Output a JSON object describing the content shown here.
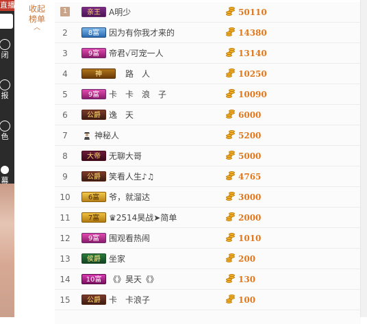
{
  "sidebar": {
    "top_tab": "直播",
    "buttons": [
      {
        "label": "闭",
        "icon": "circle-icon"
      },
      {
        "label": "报",
        "icon": "circle-icon"
      },
      {
        "label": "色",
        "icon": "circle-icon"
      },
      {
        "label": "幕",
        "icon": "toggle-dot-icon"
      }
    ]
  },
  "collapse": {
    "label_line1": "收起",
    "label_line2": "榜单",
    "icon": "chevron-up-icon"
  },
  "ranking": {
    "rows": [
      {
        "rank": "1",
        "badge": "亲王",
        "badge_type": "king",
        "name": "A明少",
        "score": "50110"
      },
      {
        "rank": "2",
        "badge": "8富",
        "badge_type": "w8",
        "name": "因为有你我才来的",
        "score": "14380"
      },
      {
        "rank": "3",
        "badge": "9富",
        "badge_type": "w9",
        "name": "帝君√可宠一人",
        "score": "13140"
      },
      {
        "rank": "4",
        "badge": "神",
        "badge_type": "god",
        "name": "路　人",
        "score": "10250"
      },
      {
        "rank": "5",
        "badge": "9富",
        "badge_type": "w9",
        "name": "卡　卡　浪　子",
        "score": "10090"
      },
      {
        "rank": "6",
        "badge": "公爵",
        "badge_type": "duke",
        "name": "逸　天",
        "score": "6000"
      },
      {
        "rank": "7",
        "badge": "",
        "badge_type": "mystery",
        "name": "神秘人",
        "score": "5200"
      },
      {
        "rank": "8",
        "badge": "大帝",
        "badge_type": "emperor",
        "name": "无聊大哥",
        "score": "5000"
      },
      {
        "rank": "9",
        "badge": "公爵",
        "badge_type": "duke",
        "name": "笑看人生♪♫",
        "score": "4765"
      },
      {
        "rank": "10",
        "badge": "6富",
        "badge_type": "w6",
        "name": "爷，就溜达",
        "score": "3000"
      },
      {
        "rank": "11",
        "badge": "7富",
        "badge_type": "w7",
        "name": "♛2514昊战➤简单",
        "score": "2000"
      },
      {
        "rank": "12",
        "badge": "9富",
        "badge_type": "w9",
        "name": "围观看热闹",
        "score": "1010"
      },
      {
        "rank": "13",
        "badge": "侯爵",
        "badge_type": "marquis",
        "name": "坐家",
        "score": "200"
      },
      {
        "rank": "14",
        "badge": "10富",
        "badge_type": "w10",
        "name": "《》昊天《》",
        "score": "130"
      },
      {
        "rank": "15",
        "badge": "公爵",
        "badge_type": "duke",
        "name": "卡　卡浪子",
        "score": "100"
      }
    ]
  },
  "colors": {
    "score": "#e1781c",
    "accent": "#c9763a"
  }
}
